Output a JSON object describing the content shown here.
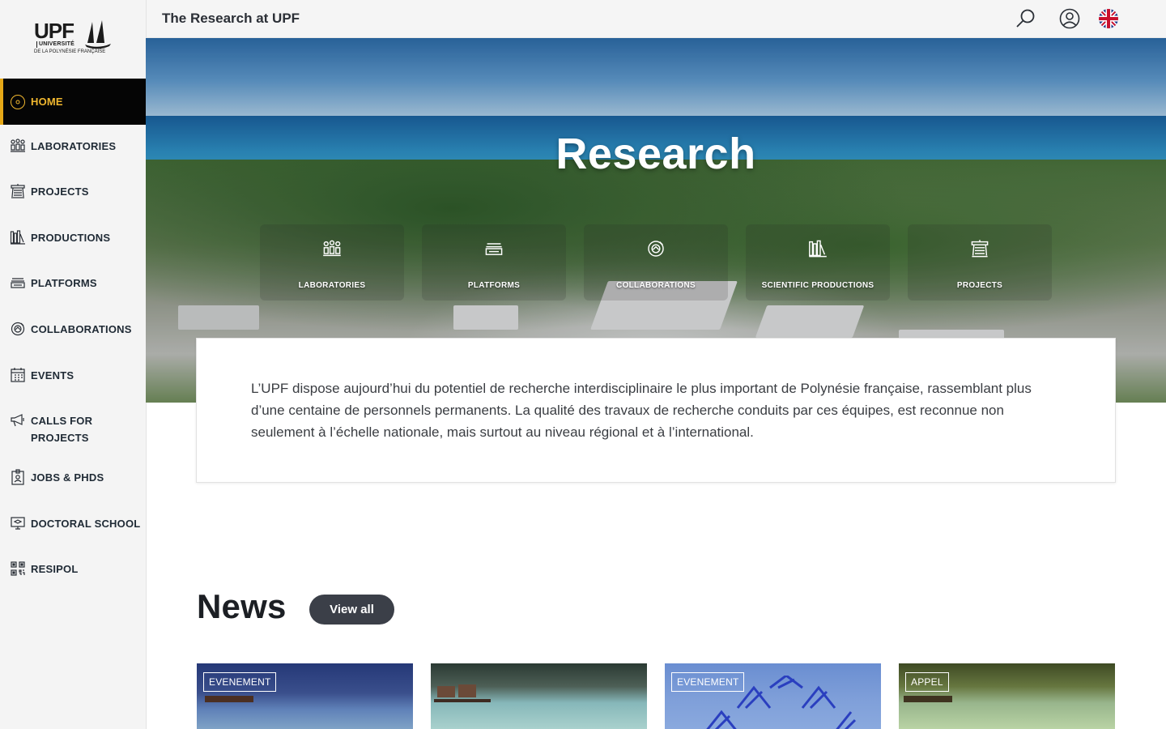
{
  "header": {
    "title": "The Research at UPF",
    "search_icon": "search-icon",
    "account_icon": "user-icon",
    "language_icon": "uk-flag-icon"
  },
  "logo": {
    "main": "UPF",
    "line1": "UNIVERSITÉ",
    "line2": "DE LA POLYNÉSIE FRANÇAISE"
  },
  "sidebar": {
    "items": [
      {
        "label": "HOME",
        "icon": "home-icon",
        "active": true
      },
      {
        "label": "LABORATORIES",
        "icon": "laboratories-icon"
      },
      {
        "label": "PROJECTS",
        "icon": "projects-icon"
      },
      {
        "label": "PRODUCTIONS",
        "icon": "productions-icon"
      },
      {
        "label": "PLATFORMS",
        "icon": "platforms-icon"
      },
      {
        "label": "COLLABORATIONS",
        "icon": "collaborations-icon"
      },
      {
        "label": "EVENTS",
        "icon": "calendar-icon"
      },
      {
        "label": "CALLS FOR PROJECTS",
        "icon": "megaphone-icon"
      },
      {
        "label": "JOBS & PHDS",
        "icon": "badge-icon"
      },
      {
        "label": "DOCTORAL SCHOOL",
        "icon": "doctoral-icon"
      },
      {
        "label": "RESIPOL",
        "icon": "qr-icon"
      }
    ]
  },
  "hero": {
    "title": "Research",
    "tiles": [
      {
        "label": "LABORATORIES",
        "icon": "laboratories-icon"
      },
      {
        "label": "PLATFORMS",
        "icon": "platforms-icon"
      },
      {
        "label": "COLLABORATIONS",
        "icon": "collaborations-icon"
      },
      {
        "label": "SCIENTIFIC PRODUCTIONS",
        "icon": "productions-icon"
      },
      {
        "label": "PROJECTS",
        "icon": "projects-icon"
      }
    ]
  },
  "intro": {
    "text": "L’UPF dispose aujourd’hui du potentiel de recherche interdisciplinaire le plus important de Polynésie française, rassemblant plus d’une centaine de personnels permanents. La qualité des travaux de recherche conduits par ces équipes, est reconnue non seulement à l’échelle nationale, mais surtout au niveau régional et à l’international."
  },
  "news": {
    "title": "News",
    "view_all": "View all",
    "cards": [
      {
        "badge": "EVENEMENT"
      },
      {
        "badge": ""
      },
      {
        "badge": "EVENEMENT"
      },
      {
        "badge": "APPEL"
      }
    ]
  },
  "colors": {
    "accent": "#f0b72f",
    "sidebar_bg": "#f4f4f4",
    "active_bg": "#050505",
    "button_bg": "#3b3f48"
  }
}
